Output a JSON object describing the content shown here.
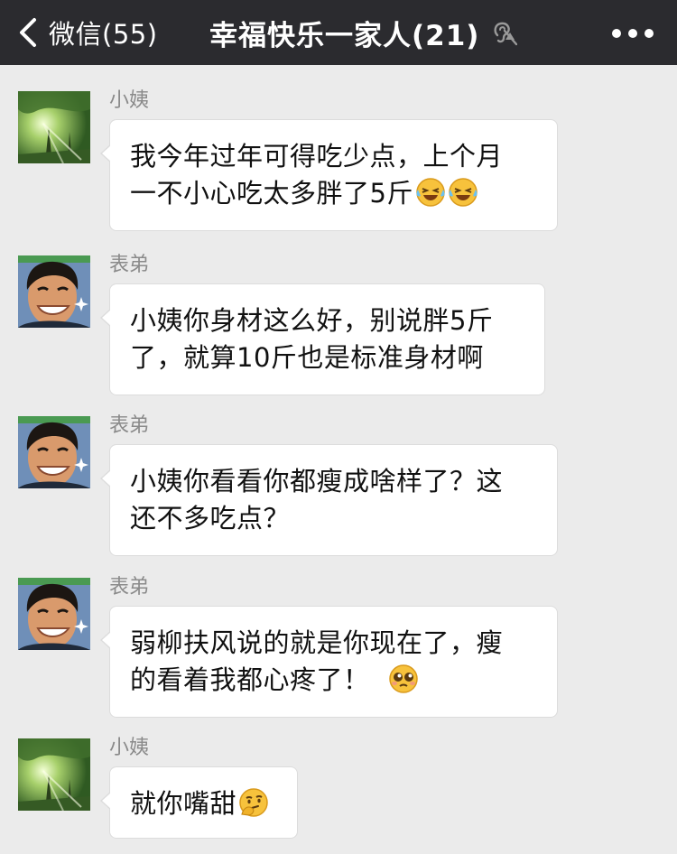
{
  "header": {
    "back_label": "微信(55)",
    "title": "幸福快乐一家人(21)",
    "icons": {
      "back": "chevron-left-icon",
      "mute": "mute-icon",
      "more": "more-icon"
    }
  },
  "colors": {
    "header_bg": "#2b2b2f",
    "chat_bg": "#ebebeb",
    "bubble_bg": "#ffffff",
    "sender_text": "#8a8a8a"
  },
  "messages": [
    {
      "sender": "小姨",
      "avatar": "forest-avatar",
      "lines": [
        "我今年过年可得吃少点，上个月",
        "一不小心吃太多胖了5斤"
      ],
      "emojis": [
        "laughing-tears-emoji",
        "laughing-tears-emoji"
      ]
    },
    {
      "sender": "表弟",
      "avatar": "smiling-man-avatar",
      "lines": [
        "小姨你身材这么好，别说胖5斤",
        "了，就算10斤也是标准身材啊"
      ],
      "emojis": []
    },
    {
      "sender": "表弟",
      "avatar": "smiling-man-avatar",
      "lines": [
        "小姨你看看你都瘦成啥样了？这",
        "还不多吃点？"
      ],
      "emojis": []
    },
    {
      "sender": "表弟",
      "avatar": "smiling-man-avatar",
      "lines": [
        "弱柳扶风说的就是你现在了，瘦",
        "的看着我都心疼了！"
      ],
      "emojis": [
        "pleading-face-emoji"
      ]
    },
    {
      "sender": "小姨",
      "avatar": "forest-avatar",
      "lines": [
        "就你嘴甜"
      ],
      "emojis": [
        "thinking-face-emoji"
      ]
    }
  ]
}
